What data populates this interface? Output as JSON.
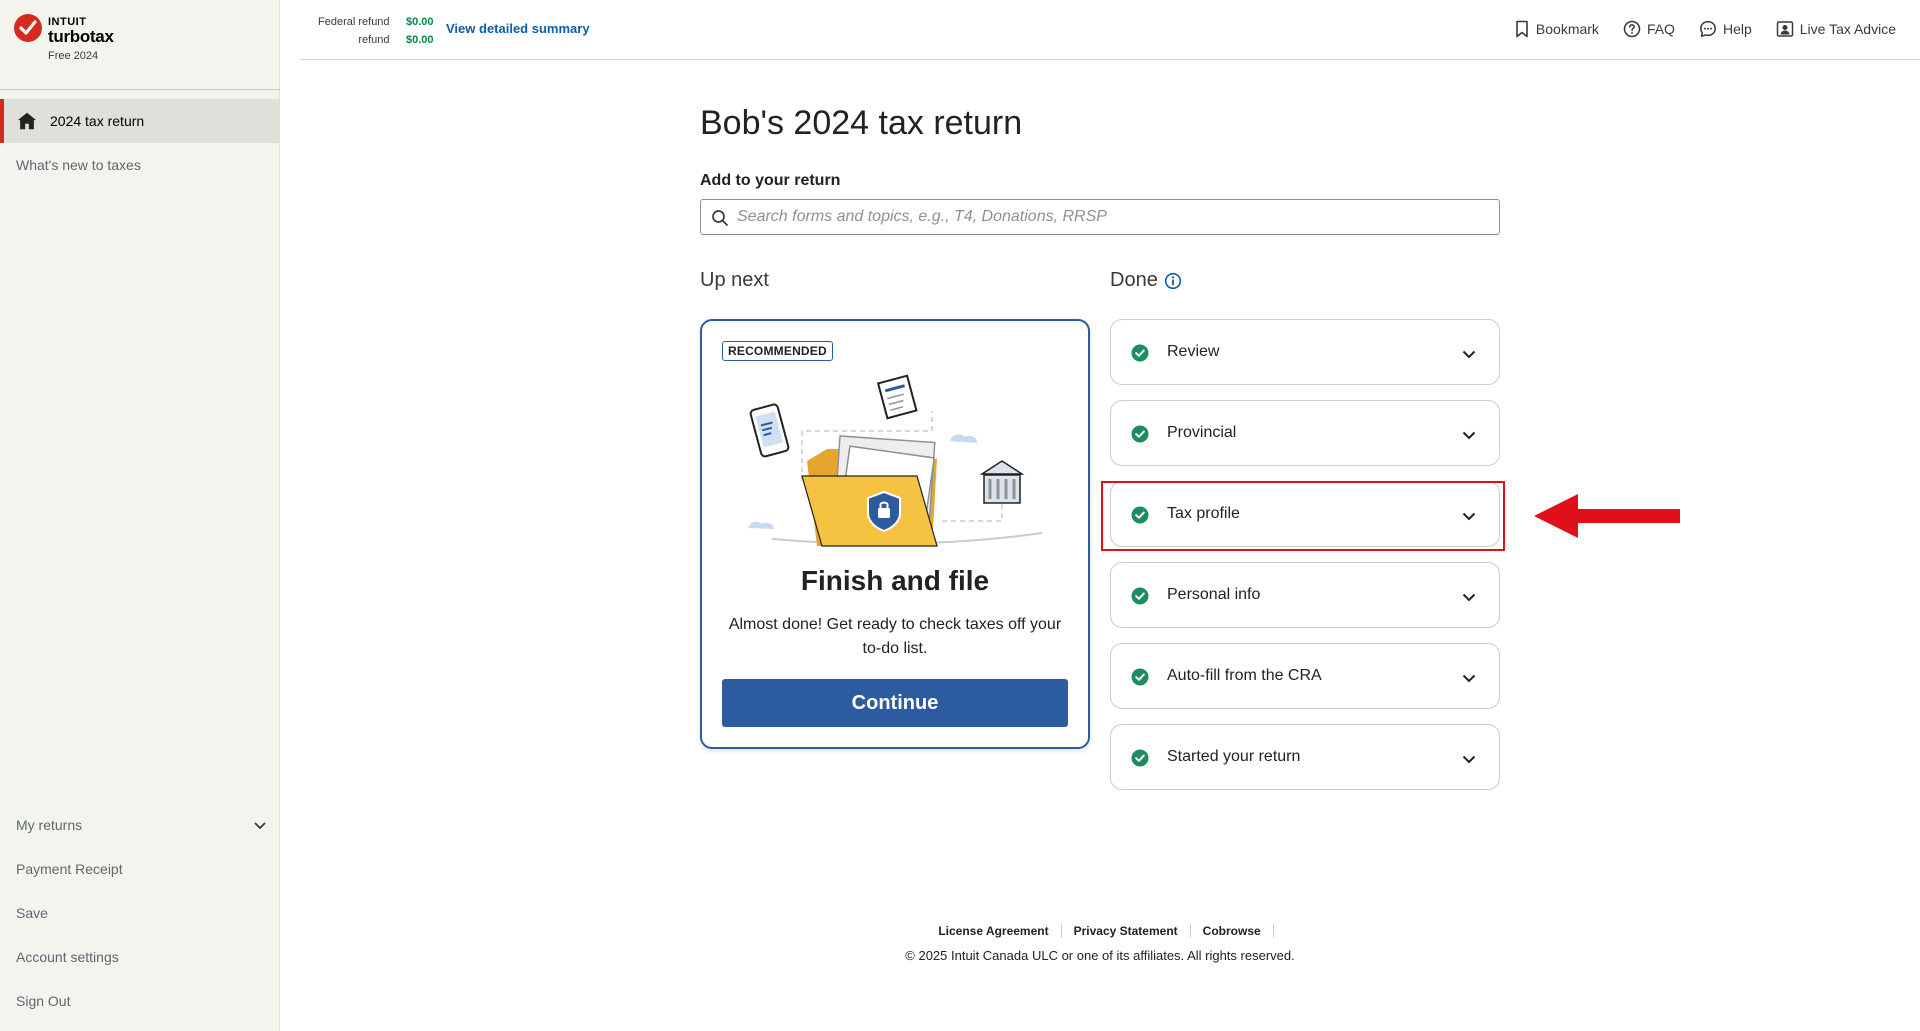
{
  "brand": {
    "company": "INTUIT",
    "product": "turbotax",
    "edition": "Free 2024"
  },
  "sidebar": {
    "items": [
      {
        "label": "2024 tax return"
      },
      {
        "label": "What's new to taxes"
      }
    ],
    "bottom_items": [
      {
        "label": "My returns"
      },
      {
        "label": "Payment Receipt"
      },
      {
        "label": "Save"
      },
      {
        "label": "Account settings"
      },
      {
        "label": "Sign Out"
      }
    ]
  },
  "header": {
    "federal_label": "Federal refund",
    "refund_label": "refund",
    "federal_value": "$0.00",
    "refund_value": "$0.00",
    "summary_link": "View detailed summary",
    "tools": [
      {
        "label": "Bookmark",
        "icon": "bookmark-icon"
      },
      {
        "label": "FAQ",
        "icon": "question-circle-icon"
      },
      {
        "label": "Help",
        "icon": "chat-icon"
      },
      {
        "label": "Live Tax Advice",
        "icon": "expert-icon"
      }
    ]
  },
  "main": {
    "title": "Bob's 2024 tax return",
    "add_label": "Add to your return",
    "search_placeholder": "Search forms and topics, e.g., T4, Donations, RRSP",
    "up_next_heading": "Up next",
    "done_heading": "Done",
    "card": {
      "badge": "RECOMMENDED",
      "title": "Finish and file",
      "description": "Almost done! Get ready to check taxes off your to-do list.",
      "button": "Continue"
    },
    "done_items": [
      {
        "label": "Review"
      },
      {
        "label": "Provincial"
      },
      {
        "label": "Tax profile"
      },
      {
        "label": "Personal info"
      },
      {
        "label": "Auto-fill from the CRA"
      },
      {
        "label": "Started your return"
      }
    ]
  },
  "footer": {
    "links": [
      "License Agreement",
      "Privacy Statement",
      "Cobrowse"
    ],
    "copyright": "© 2025 Intuit Canada ULC or one of its affiliates. All rights reserved."
  },
  "colors": {
    "accent_blue": "#2d5b9f",
    "success_green": "#2ca01c",
    "brand_red": "#d52b1e",
    "annotation_red": "#e0101a"
  }
}
